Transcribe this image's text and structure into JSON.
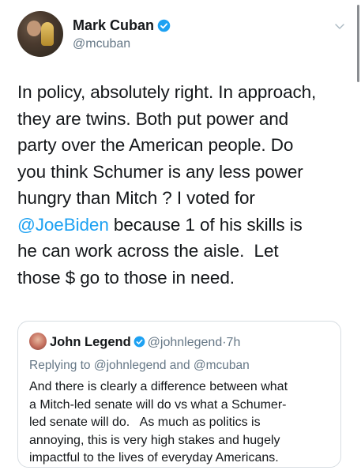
{
  "tweet": {
    "author": {
      "display_name": "Mark Cuban",
      "handle": "@mcuban",
      "verified": true,
      "avatar_icon": "user-avatar-photo"
    },
    "menu_icon": "chevron-down-icon",
    "text_lines": [
      "In policy, absolutely right. In approach,",
      "they are twins. Both put power and",
      "party over the American people. Do",
      "you think Schumer is any less power",
      "hungry than Mitch ? I voted for",
      "@JoeBiden",
      " because 1 of his skills is",
      "he can work across the aisle.  Let",
      "those $ go to those in need."
    ]
  },
  "quoted_tweet": {
    "display_name": "John Legend",
    "handle": "@johnlegend",
    "separator": "·",
    "time": "7h",
    "replying_to": "Replying to @johnlegend and @mcuban",
    "text_lines": [
      "And there is clearly a difference between what",
      "a Mitch-led senate will do vs what a Schumer-",
      "led senate will do.   As much as politics is",
      "annoying, this is very high stakes and hugely",
      "impactful to the lives of everyday Americans."
    ]
  },
  "colors": {
    "link": "#1da1f2",
    "verified_badge": "#1da1f2",
    "secondary_text": "#657786",
    "border": "#d7dde2"
  }
}
